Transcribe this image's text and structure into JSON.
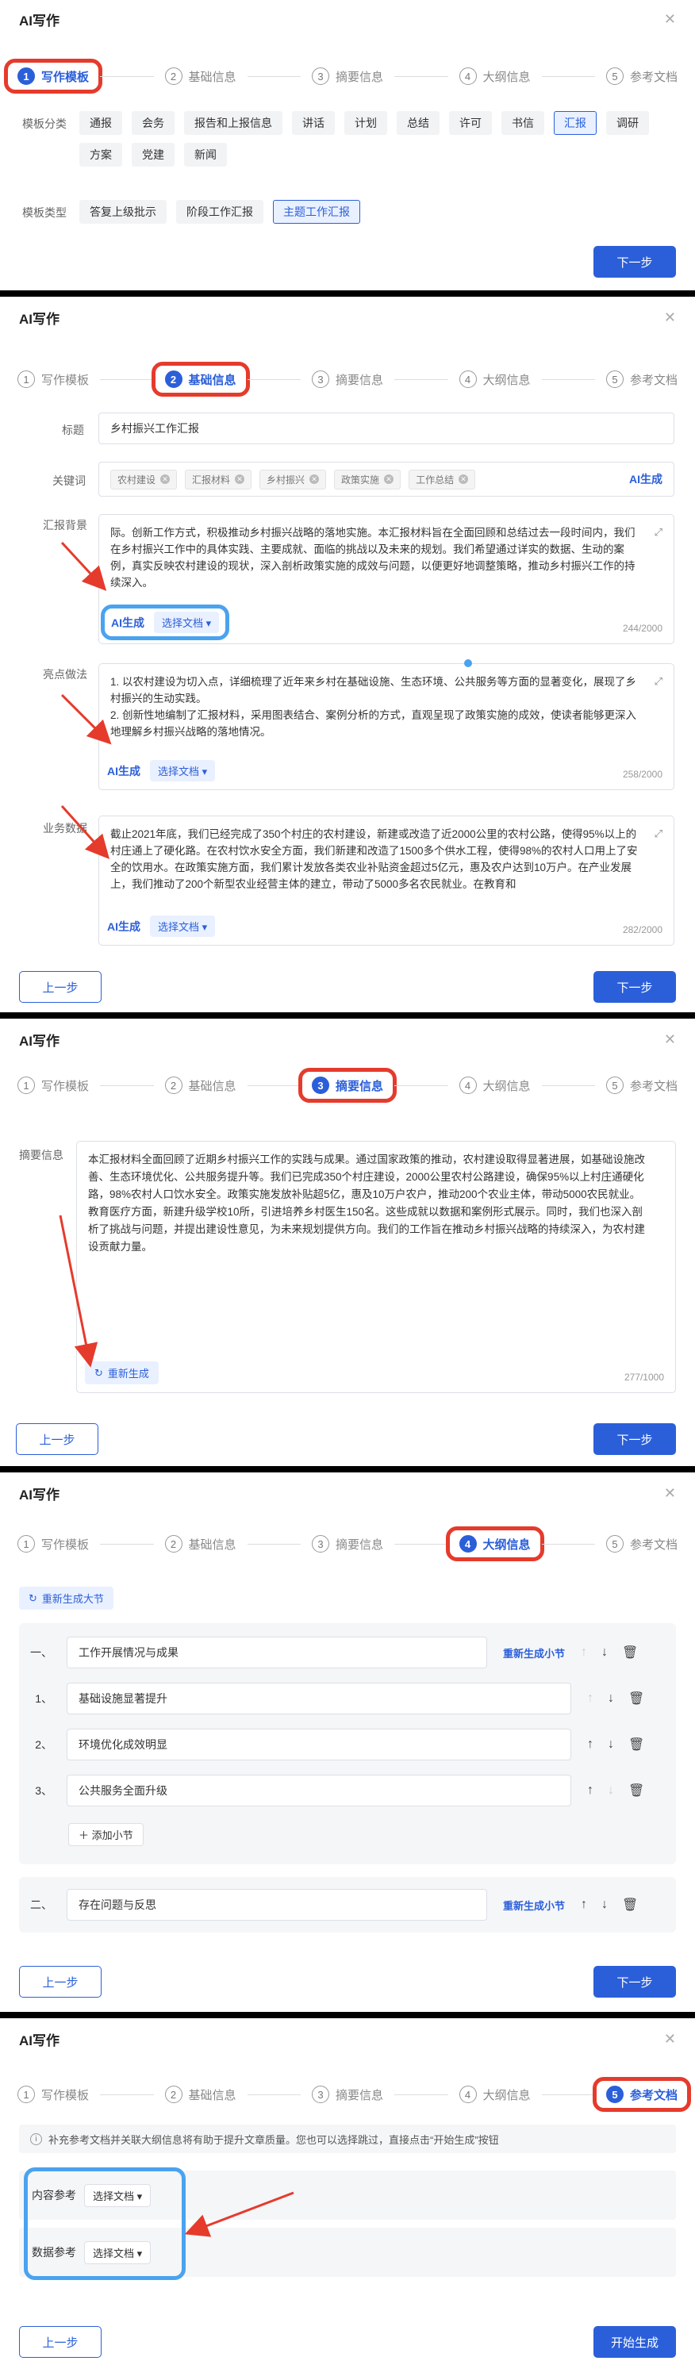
{
  "app_title": "AI写作",
  "steps": [
    "写作模板",
    "基础信息",
    "摘要信息",
    "大纲信息",
    "参考文档"
  ],
  "buttons": {
    "next": "下一步",
    "prev": "上一步",
    "start": "开始生成",
    "ai_gen": "AI生成",
    "select_doc": "选择文档",
    "regenerate": "重新生成",
    "regen_section": "重新生成小节",
    "add_sub": "添加小节"
  },
  "step1": {
    "category_label": "模板分类",
    "categories": [
      "通报",
      "会务",
      "报告和上报信息",
      "讲话",
      "计划",
      "总结",
      "许可",
      "书信",
      "汇报",
      "调研",
      "方案",
      "党建",
      "新闻"
    ],
    "selected_category": "汇报",
    "type_label": "模板类型",
    "types": [
      "答复上级批示",
      "阶段工作汇报",
      "主题工作汇报"
    ],
    "selected_type": "主题工作汇报"
  },
  "step2": {
    "title_label": "标题",
    "title_value": "乡村振兴工作汇报",
    "keywords_label": "关键词",
    "keywords": [
      "农村建设",
      "汇报材料",
      "乡村振兴",
      "政策实施",
      "工作总结"
    ],
    "bg_label": "汇报背景",
    "bg_text": "际。创新工作方式，积极推动乡村振兴战略的落地实施。本汇报材料旨在全面回顾和总结过去一段时间内，我们在乡村振兴工作中的具体实践、主要成就、面临的挑战以及未来的规划。我们希望通过详实的数据、生动的案例，真实反映农村建设的现状，深入剖析政策实施的成效与问题，以便更好地调整策略，推动乡村振兴工作的持续深入。",
    "bg_count": "244/2000",
    "hl_label": "亮点做法",
    "hl_text": "1. 以农村建设为切入点，详细梳理了近年来乡村在基础设施、生态环境、公共服务等方面的显著变化，展现了乡村振兴的生动实践。\n2. 创新性地编制了汇报材料，采用图表结合、案例分析的方式，直观呈现了政策实施的成效，使读者能够更深入地理解乡村振兴战略的落地情况。",
    "hl_count": "258/2000",
    "data_label": "业务数据",
    "data_text": "截止2021年底，我们已经完成了350个村庄的农村建设，新建或改造了近2000公里的农村公路，使得95%以上的村庄通上了硬化路。在农村饮水安全方面，我们新建和改造了1500多个供水工程，使得98%的农村人口用上了安全的饮用水。在政策实施方面，我们累计发放各类农业补贴资金超过5亿元，惠及农户达到10万户。在产业发展上，我们推动了200个新型农业经营主体的建立，带动了5000多名农民就业。在教育和",
    "data_count": "282/2000"
  },
  "step3": {
    "label": "摘要信息",
    "text": "本汇报材料全面回顾了近期乡村振兴工作的实践与成果。通过国家政策的推动，农村建设取得显著进展，如基础设施改善、生态环境优化、公共服务提升等。我们已完成350个村庄建设，2000公里农村公路建设，确保95%以上村庄通硬化路，98%农村人口饮水安全。政策实施发放补贴超5亿，惠及10万户农户，推动200个农业主体，带动5000农民就业。教育医疗方面，新建升级学校10所，引进培养乡村医生150名。这些成就以数据和案例形式展示。同时，我们也深入剖析了挑战与问题，并提出建设性意见，为未来规划提供方向。我们的工作旨在推动乡村振兴战略的持续深入，为农村建设贡献力量。",
    "count": "277/1000"
  },
  "step4": {
    "regen_top": "重新生成大节",
    "sections": [
      {
        "num": "一、",
        "title": "工作开展情况与成果",
        "subs": [
          {
            "num": "1、",
            "title": "基础设施显著提升"
          },
          {
            "num": "2、",
            "title": "环境优化成效明显"
          },
          {
            "num": "3、",
            "title": "公共服务全面升级"
          }
        ]
      },
      {
        "num": "二、",
        "title": "存在问题与反思",
        "subs": []
      }
    ]
  },
  "step5": {
    "notice": "补充参考文档并关联大纲信息将有助于提升文章质量。您也可以选择跳过，直接点击“开始生成”按钮",
    "content_ref": "内容参考",
    "data_ref": "数据参考"
  },
  "colors": {
    "primary": "#2b5fd9",
    "highlight_red": "#e53b2c",
    "highlight_blue": "#4aa3ef"
  }
}
